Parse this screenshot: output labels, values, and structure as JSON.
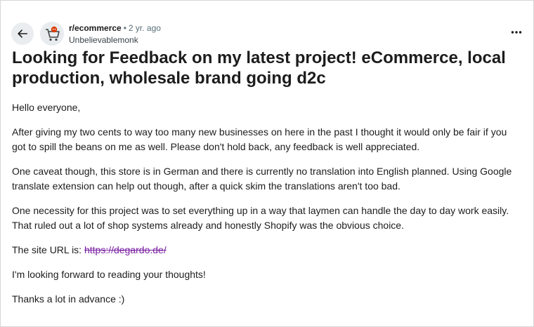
{
  "post": {
    "subreddit": "r/ecommerce",
    "separator": "•",
    "age": "2 yr. ago",
    "username": "Unbelievablemonk",
    "title": "Looking for Feedback on my latest project! eCommerce, local production, wholesale brand going d2c",
    "body": {
      "greeting": "Hello everyone,",
      "paragraph1": "After giving my two cents to way too many new businesses on here in the past I thought it would only be fair if you got to spill the beans on me as well. Please don't hold back, any feedback is well appreciated.",
      "paragraph2": "One caveat though, this store is in German and there is currently no translation into English planned. Using Google translate extension can help out though, after a quick skim the translations aren't too bad.",
      "paragraph3": "One necessity for this project was to set everything up in a way that laymen can handle the day to day work easily. That ruled out a lot of shop systems already and honestly Shopify was the obvious choice.",
      "url_prefix": "The site URL is: ",
      "url": "https://degardo.de/",
      "paragraph4": "I'm looking forward to reading your thoughts!",
      "closing": "Thanks a lot in advance :)"
    }
  },
  "icons": {
    "back": "arrow-left-icon",
    "more": "more-horizontal-icon",
    "avatar": "shopping-cart-avatar"
  },
  "colors": {
    "link_visited": "#7a1fa2",
    "meta_gray": "#576f76",
    "button_bg": "#eaedef"
  }
}
